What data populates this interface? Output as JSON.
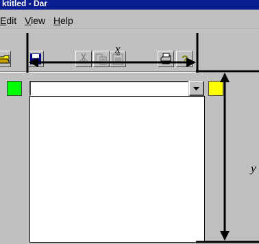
{
  "window": {
    "title": "ktitled - Dar"
  },
  "menu": {
    "items": [
      {
        "label": "dit",
        "accel": "E"
      },
      {
        "label": "iew",
        "accel": "V"
      },
      {
        "label": "elp",
        "accel": "H"
      }
    ]
  },
  "toolbar": {
    "buttons": [
      "open-folder-icon",
      "save-disk-icon",
      "cut-scissors-icon",
      "copy-icon",
      "paste-icon",
      "print-icon",
      "help-icon"
    ]
  },
  "colorbar": {
    "left_swatch_color": "#00ff00",
    "right_swatch_color": "#ffff00",
    "combo_value": ""
  },
  "annotations": {
    "horizontal_label": "x",
    "vertical_label": "y"
  },
  "colors": {
    "titlebar": "#0a1f8f",
    "face": "#c0c0c0"
  }
}
